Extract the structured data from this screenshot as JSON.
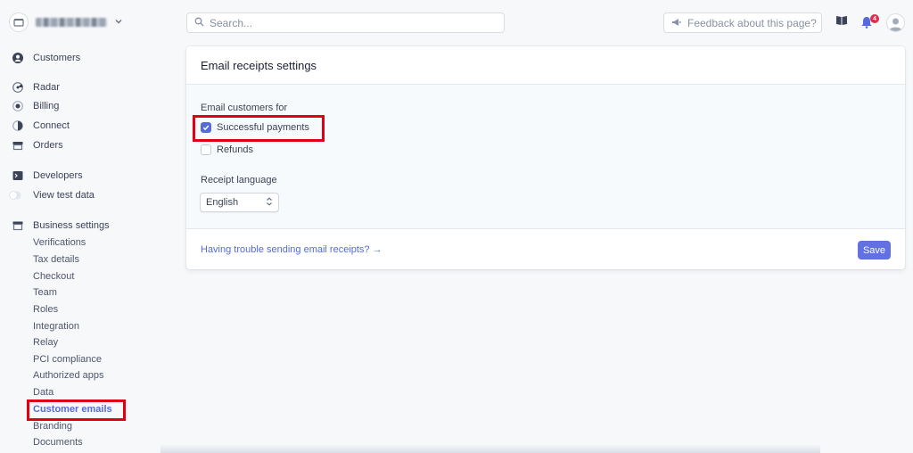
{
  "search": {
    "placeholder": "Search..."
  },
  "header": {
    "feedback_label": "Feedback about this page?",
    "notification_count": "4"
  },
  "sidebar": {
    "customers": "Customers",
    "radar": "Radar",
    "billing": "Billing",
    "connect": "Connect",
    "orders": "Orders",
    "developers": "Developers",
    "view_test_data": "View test data",
    "business_settings": "Business settings",
    "sub_items": [
      "Verifications",
      "Tax details",
      "Checkout",
      "Team",
      "Roles",
      "Integration",
      "Relay",
      "PCI compliance",
      "Authorized apps",
      "Data",
      "Customer emails",
      "Branding",
      "Documents"
    ],
    "active_item": "Customer emails"
  },
  "card": {
    "title": "Email receipts settings",
    "email_customers_label": "Email customers for",
    "successful_payments": {
      "label": "Successful payments",
      "checked": true
    },
    "refunds": {
      "label": "Refunds",
      "checked": false
    },
    "receipt_language_label": "Receipt language",
    "receipt_language_value": "English",
    "trouble_link": "Having trouble sending email receipts? →",
    "save_label": "Save"
  },
  "colors": {
    "accent": "#556cd6",
    "highlight": "#e00016",
    "badge": "#e02d4c"
  }
}
